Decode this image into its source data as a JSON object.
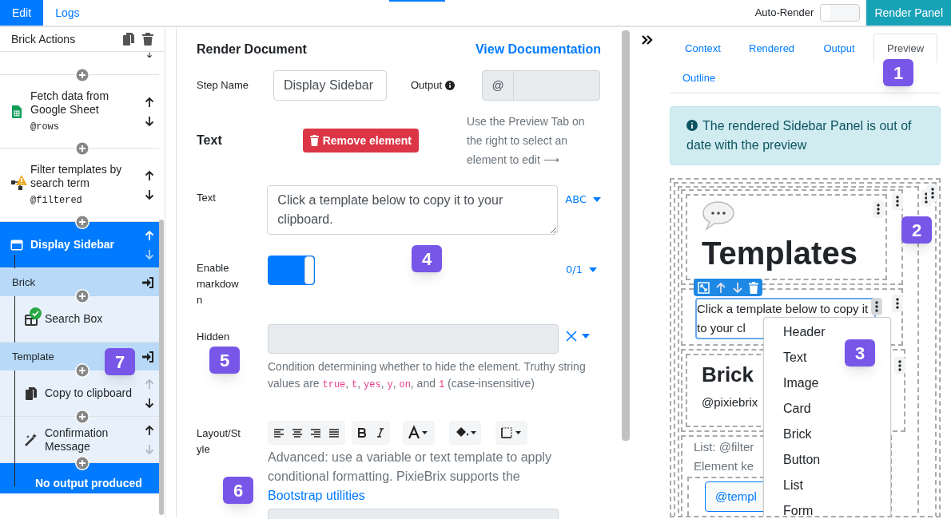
{
  "top_bar": {
    "tabs": [
      {
        "label": "Edit",
        "selected": true
      },
      {
        "label": "Logs",
        "selected": false
      }
    ],
    "auto_render": {
      "label": "Auto-Render",
      "on": false
    },
    "render_button": "Render Panel"
  },
  "brick_actions": {
    "title": "Brick Actions",
    "items": [
      {
        "kind": "stub"
      },
      {
        "kind": "brick",
        "title": "Fetch data from Google Sheet",
        "output": "@rows",
        "can_move_up": true,
        "can_move_down": true,
        "selected": false
      },
      {
        "kind": "brick",
        "title": "Filter templates by search term",
        "output": "@filtered",
        "warning": true,
        "can_move_up": true,
        "can_move_down": true,
        "selected": false
      },
      {
        "kind": "brick",
        "title": "Display Sidebar",
        "can_move_up": true,
        "can_move_down": false,
        "selected": true,
        "children": [
          {
            "kind": "slot",
            "title": "Brick",
            "children": [
              {
                "kind": "brick",
                "title": "Search Box",
                "valid": true,
                "selected": false
              }
            ]
          },
          {
            "kind": "slot",
            "title": "Template",
            "children": [
              {
                "kind": "brick",
                "title": "Copy to clipboard",
                "can_move_up": false,
                "can_move_down": true,
                "selected": false
              },
              {
                "kind": "brick",
                "title": "Confirmation Message",
                "can_move_up": true,
                "can_move_down": false,
                "selected": false
              }
            ]
          }
        ]
      },
      {
        "kind": "footer",
        "title": "No output produced"
      }
    ]
  },
  "editor": {
    "title": "Render Document",
    "doc_link": "View Documentation",
    "step_name": {
      "label": "Step Name",
      "value": "Display Sidebar"
    },
    "output": {
      "label": "Output",
      "prefix": "@"
    },
    "element": {
      "heading": "Text",
      "remove_button": "Remove element",
      "hint": "Use the Preview Tab on the right to select an element to edit ⟶"
    },
    "fields": [
      {
        "kind": "textarea",
        "label": "Text",
        "value": "Click a template below to copy it to your clipboard.",
        "mode": "ABC"
      },
      {
        "kind": "toggle",
        "label": "Enable markdown",
        "on": true,
        "mode": "0/1"
      },
      {
        "kind": "condition",
        "label": "Hidden",
        "help": [
          {
            "text": "Condition determining whether to hide the element. Truthy string values are ",
            "code": false
          },
          {
            "text": "true",
            "code": true
          },
          {
            "text": ", ",
            "code": false
          },
          {
            "text": "t",
            "code": true
          },
          {
            "text": ", ",
            "code": false
          },
          {
            "text": "yes",
            "code": true
          },
          {
            "text": ", ",
            "code": false
          },
          {
            "text": "y",
            "code": true
          },
          {
            "text": ", ",
            "code": false
          },
          {
            "text": "on",
            "code": true
          },
          {
            "text": ", and ",
            "code": false
          },
          {
            "text": "1",
            "code": true
          },
          {
            "text": " (case-insensitive)",
            "code": false
          }
        ]
      },
      {
        "kind": "style",
        "label": "Layout/Style",
        "help": "Advanced: use a variable or text template to apply conditional formatting. PixieBrix supports the ",
        "link": "Bootstrap utilities"
      }
    ]
  },
  "preview": {
    "tabs": [
      {
        "label": "Context",
        "selected": false
      },
      {
        "label": "Rendered",
        "selected": false
      },
      {
        "label": "Output",
        "selected": false
      },
      {
        "label": "Preview",
        "selected": true
      },
      {
        "label": "Outline",
        "selected": false
      }
    ],
    "alert": "The rendered Sidebar Panel is out of date with the preview",
    "header_title": "Templates",
    "text": "Click a template below to copy it to your cl",
    "brick_title": "Brick",
    "brick_subtitle": "@pixiebrix",
    "list_label": "List: @filter",
    "element_key": "Element ke",
    "template_button": "@templ",
    "menu": [
      "Header",
      "Text",
      "Image",
      "Card",
      "Brick",
      "Button",
      "List",
      "Form"
    ]
  },
  "callouts": [
    "1",
    "2",
    "3",
    "4",
    "5",
    "6",
    "7"
  ]
}
